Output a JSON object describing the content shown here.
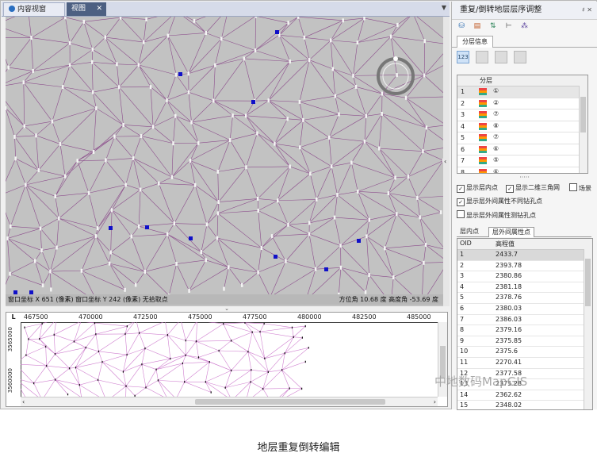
{
  "tabs": [
    {
      "label": "内容视窗"
    },
    {
      "label": "视图"
    }
  ],
  "statusbar": {
    "left": "窗口坐标 X 651 (像素) 窗口坐标 Y 242 (像素) 无拾取点",
    "right": "方位角   10.68  度   高度角   -53.69  度"
  },
  "ruler": {
    "corner": "L",
    "x_ticks": [
      "467500",
      "470000",
      "472500",
      "475000",
      "477500",
      "480000",
      "482500",
      "485000"
    ],
    "y_ticks": [
      "3565000",
      "3560000"
    ]
  },
  "panel": {
    "title": "重复/倒转地层层序调整",
    "title_tools": "♯ ✕",
    "tab": "分层信息",
    "layer_header": "分层",
    "layers": [
      {
        "n": "1",
        "name": "①"
      },
      {
        "n": "2",
        "name": "②"
      },
      {
        "n": "3",
        "name": "⑦"
      },
      {
        "n": "4",
        "name": "⑧"
      },
      {
        "n": "5",
        "name": "⑦"
      },
      {
        "n": "6",
        "name": "⑥"
      },
      {
        "n": "7",
        "name": "⑤"
      },
      {
        "n": "8",
        "name": "⑥"
      }
    ],
    "dots": "·····",
    "checks": {
      "show_inner": "显示层内点",
      "show_tin": "显示二维三角网",
      "field": "场景",
      "show_outer_nohole": "显示层外间属性不同钻孔点",
      "show_outer_hole": "显示层外间属性测钻孔点"
    },
    "attr_tabs": [
      "层内点",
      "层外间属性点"
    ],
    "attr_header": {
      "oid": "OID",
      "elev": "高程值"
    },
    "attr_rows": [
      {
        "oid": "1",
        "v": "2433.7"
      },
      {
        "oid": "2",
        "v": "2393.78"
      },
      {
        "oid": "3",
        "v": "2380.86"
      },
      {
        "oid": "4",
        "v": "2381.18"
      },
      {
        "oid": "5",
        "v": "2378.76"
      },
      {
        "oid": "6",
        "v": "2380.03"
      },
      {
        "oid": "7",
        "v": "2386.03"
      },
      {
        "oid": "8",
        "v": "2379.16"
      },
      {
        "oid": "9",
        "v": "2375.85"
      },
      {
        "oid": "10",
        "v": "2375.6"
      },
      {
        "oid": "11",
        "v": "2270.41"
      },
      {
        "oid": "12",
        "v": "2377.58"
      },
      {
        "oid": "13",
        "v": "2375.28"
      },
      {
        "oid": "14",
        "v": "2362.62"
      },
      {
        "oid": "15",
        "v": "2348.02"
      }
    ]
  },
  "watermark": "中地数码MapGIS",
  "caption": "地层重复倒转编辑"
}
